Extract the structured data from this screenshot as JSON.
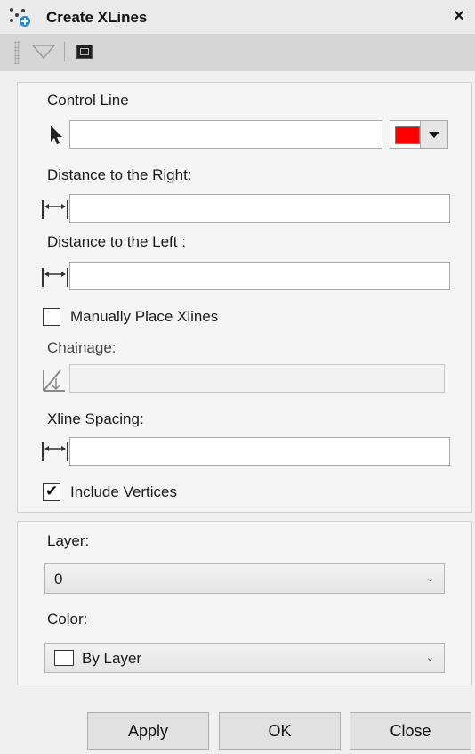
{
  "window": {
    "title": "Create XLines",
    "close_glyph": "×"
  },
  "toolbar": {
    "icons": [
      "grip-handle",
      "filter-triangle-icon",
      "terminal-icon"
    ]
  },
  "control_line": {
    "label": "Control Line",
    "value": "",
    "color": "#ff0000"
  },
  "distance_right": {
    "label": "Distance to the Right:",
    "value": ""
  },
  "distance_left": {
    "label": "Distance to the Left :",
    "value": ""
  },
  "manual_place": {
    "label": "Manually Place Xlines",
    "checked": false
  },
  "chainage": {
    "label": "Chainage:",
    "value": "",
    "enabled": false
  },
  "xline_spacing": {
    "label": "Xline Spacing:",
    "value": ""
  },
  "include_vertices": {
    "label": "Include Vertices",
    "checked": true,
    "mark": "✔"
  },
  "layer": {
    "label": "Layer:",
    "selected": "0"
  },
  "color": {
    "label": "Color:",
    "selected": "By Layer"
  },
  "chevron": "⌄",
  "buttons": {
    "apply": "Apply",
    "ok": "OK",
    "close": "Close"
  }
}
